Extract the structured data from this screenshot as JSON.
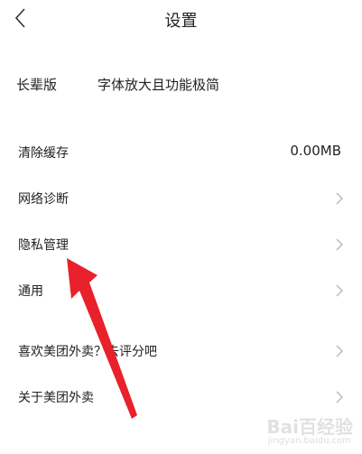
{
  "header": {
    "title": "设置"
  },
  "elder_mode": {
    "label": "长辈版",
    "description": "字体放大且功能极简"
  },
  "items": [
    {
      "label": "清除缓存",
      "value": "0.00MB"
    },
    {
      "label": "网络诊断"
    },
    {
      "label": "隐私管理"
    },
    {
      "label": "通用"
    },
    {
      "label": "喜欢美团外卖？去评分吧"
    },
    {
      "label": "关于美团外卖"
    }
  ],
  "icons": {
    "back": "chevron-left-icon",
    "row_arrow": "chevron-right-icon"
  },
  "colors": {
    "annotation_arrow": "#e8212a",
    "chevron": "#b5b5b5"
  },
  "watermark": {
    "text": "Bai百经验",
    "sub": "jingyan.baidu.com"
  }
}
